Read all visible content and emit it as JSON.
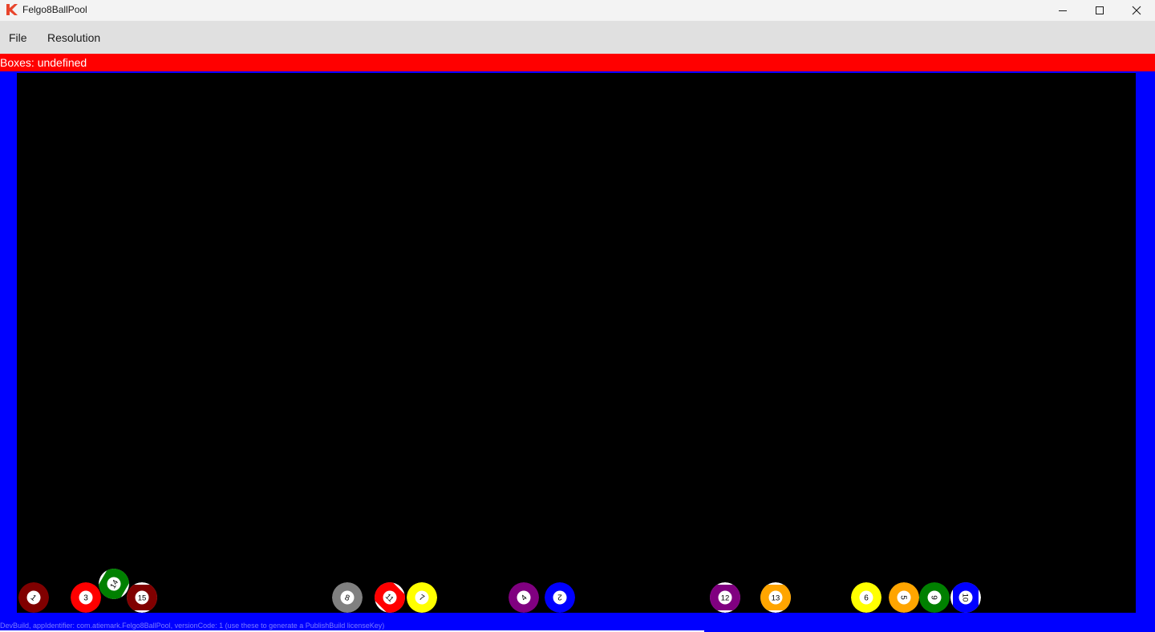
{
  "window": {
    "title": "Felgo8BallPool",
    "controls": {
      "minimize": "minimize-icon",
      "maximize": "maximize-icon",
      "close": "close-icon"
    }
  },
  "menu": {
    "file": "File",
    "resolution": "Resolution"
  },
  "status": {
    "text": "Boxes: undefined",
    "color": "#ff0000"
  },
  "colors": {
    "frame": "#0000ff",
    "table": "#000000"
  },
  "balls": [
    {
      "number": "1",
      "color": "#800000",
      "striped": false,
      "rotation": 40
    },
    {
      "number": "3",
      "color": "#ff0000",
      "striped": false,
      "rotation": 0
    },
    {
      "number": "14",
      "color": "#008000",
      "striped": true,
      "rotation": -60
    },
    {
      "number": "15",
      "color": "#800000",
      "striped": true,
      "rotation": 0
    },
    {
      "number": "8",
      "color": "#808080",
      "striped": false,
      "rotation": 20
    },
    {
      "number": "11",
      "color": "#ff0000",
      "striped": true,
      "rotation": 45
    },
    {
      "number": "7",
      "color": "#ffff00",
      "striped": false,
      "rotation": 30
    },
    {
      "number": "4",
      "color": "#800080",
      "striped": false,
      "rotation": -45
    },
    {
      "number": "2",
      "color": "#0000ff",
      "striped": false,
      "rotation": 180
    },
    {
      "number": "12",
      "color": "#800080",
      "striped": true,
      "rotation": 0
    },
    {
      "number": "13",
      "color": "#ffa500",
      "striped": true,
      "rotation": 0
    },
    {
      "number": "6",
      "color": "#ffff00",
      "striped": false,
      "rotation": 0
    },
    {
      "number": "5",
      "color": "#ffa500",
      "striped": false,
      "rotation": 90
    },
    {
      "number": "9",
      "color": "#008000",
      "striped": false,
      "rotation": 90
    },
    {
      "number": "10",
      "color": "#0000ff",
      "striped": true,
      "rotation": 90
    }
  ],
  "footer": {
    "text": "DevBuild, appIdentifier: com.atiemark.Felgo8BallPool, versionCode: 1 (use these to generate a PublishBuild licenseKey)"
  }
}
